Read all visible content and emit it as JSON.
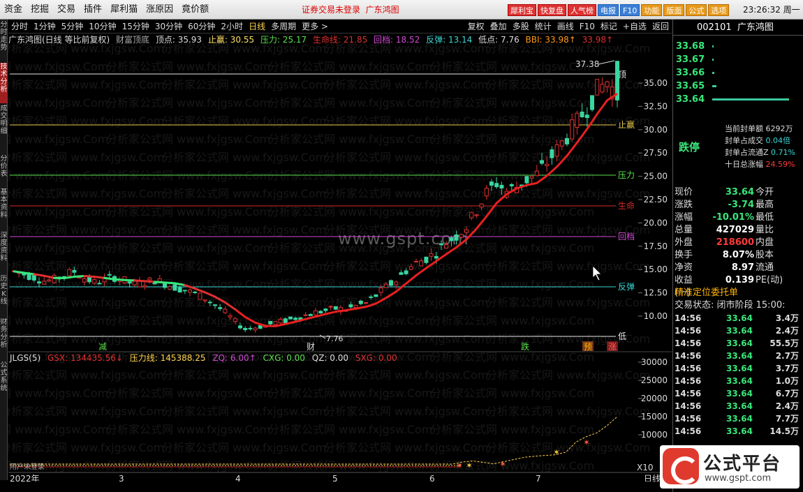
{
  "menu": {
    "items": [
      "资金",
      "挖掘",
      "交易",
      "插件",
      "犀利猫",
      "涨原因",
      "竟价额"
    ]
  },
  "account": {
    "status": "证券交易未登录",
    "name": "广东鸿图"
  },
  "topbuttons": [
    "犀利宝",
    "快复盘",
    "人气榜",
    "电报",
    "F10",
    "功能",
    "版面",
    "公式",
    "选项"
  ],
  "clock": "23:26:32 周一",
  "lefttabs": [
    "分时走势",
    "技术分析",
    "成交明细",
    "分价表",
    "基本资料",
    "深度资料",
    "历史K线",
    "财务分析",
    "公式系统"
  ],
  "periods": {
    "items": [
      "分时",
      "1分钟",
      "5分钟",
      "10分钟",
      "15分钟",
      "30分钟",
      "60分钟",
      "2小时",
      "日线",
      "多周期",
      "更多 >"
    ],
    "active": "日线"
  },
  "toolbar": [
    "复权",
    "叠加",
    "多股",
    "统计",
    "画线",
    "F10",
    "标记",
    "+自选",
    "返回"
  ],
  "info": {
    "title": "广东鸿图(日线 等比前复权)",
    "indicator": "财富顶底",
    "top": "顶点: 35.93",
    "stop": "止赢: 30.55",
    "press": "压力: 25.17",
    "life": "生命线: 21.85",
    "ret": "回档: 18.52",
    "rebound": "反弹: 13.14",
    "low": "低点: 7.76",
    "bbi": "BBI: 33.98↑",
    "bbi2": "33.98↑"
  },
  "levels": {
    "top": "顶",
    "stop": "止赢",
    "press": "压力",
    "life": "生命",
    "ret": "回档",
    "rebound": "反弹",
    "low": "低"
  },
  "pricelabels": {
    "high": "37.38",
    "low": "7.76"
  },
  "signals": {
    "s1": "减",
    "s2": "财",
    "s3": "跌",
    "s4": "预",
    "s5": "涨"
  },
  "indicator2": {
    "name": "JLGS(5)",
    "gsx": "GSX: 134435.56↓",
    "ylx": "压力线: 145388.25",
    "zq": "ZQ: 6.00↑",
    "cxg": "CXG: 0.00",
    "qz": "QZ: 0.00",
    "sxg": "SXG: 0.00",
    "foot": "用户未登录",
    "unit": "X10"
  },
  "xaxis": {
    "labels": [
      "2022年",
      "3",
      "4",
      "5",
      "6",
      "7"
    ],
    "right": "日线"
  },
  "rightpanel": {
    "code": "002101",
    "name": "广东鸿图",
    "orderbook": [
      {
        "price": "33.68",
        "bar": 2
      },
      {
        "price": "33.67",
        "bar": 2
      },
      {
        "price": "33.66",
        "bar": 3
      },
      {
        "price": "33.65",
        "bar": 6
      },
      {
        "price": "33.64",
        "bar": 110
      }
    ],
    "halt": {
      "label": "跌停",
      "r1": "当前封单额",
      "r1v": "6292万",
      "r2": "封单占成交",
      "r2v": "0.04倍",
      "r3": "封单占流通Z",
      "r3v": "0.71%",
      "r4": "十日总涨幅",
      "r4v": "24.59%"
    },
    "stats": [
      {
        "k": "现价",
        "v": "33.64",
        "c": "#38e77a",
        "k2": "今开"
      },
      {
        "k": "涨跌",
        "v": "-3.74",
        "c": "#38e77a",
        "k2": "最高"
      },
      {
        "k": "涨幅",
        "v": "-10.01%",
        "c": "#38e77a",
        "k2": "最低"
      },
      {
        "k": "总量",
        "v": "427029",
        "c": "#ffffff",
        "k2": "量比"
      },
      {
        "k": "外盘",
        "v": "218600",
        "c": "#ff3b3b",
        "k2": "内盘"
      },
      {
        "k": "换手",
        "v": "8.07%",
        "c": "#ffffff",
        "k2": "股本"
      },
      {
        "k": "净资",
        "v": "8.97",
        "c": "#ffffff",
        "k2": "流通"
      },
      {
        "k": "收益(一)",
        "v": "0.139",
        "c": "#ffffff",
        "k2": "PE(动)"
      }
    ],
    "section": "精准定位委托单",
    "tradestate": "交易状态: 闭市阶段 15:00:",
    "trades": [
      {
        "t": "14:56",
        "p": "33.64",
        "q": "3.4万"
      },
      {
        "t": "14:56",
        "p": "33.64",
        "q": "2.4万"
      },
      {
        "t": "14:56",
        "p": "33.64",
        "q": "55.5万"
      },
      {
        "t": "14:56",
        "p": "33.64",
        "q": "2.7万"
      },
      {
        "t": "14:56",
        "p": "33.64",
        "q": "3.7万"
      },
      {
        "t": "14:56",
        "p": "33.64",
        "q": "1.0万"
      },
      {
        "t": "14:56",
        "p": "33.64",
        "q": "6.7万"
      },
      {
        "t": "14:56",
        "p": "33.64",
        "q": "2.4万"
      },
      {
        "t": "14:56",
        "p": "33.64",
        "q": "7.7万"
      },
      {
        "t": "14:56",
        "p": "33.64",
        "q": "14.5万"
      }
    ]
  },
  "logo": {
    "name": "公式平台",
    "url": "www.gspt.com"
  },
  "watermark": {
    "big": "www.gspt.com",
    "tile": "分析家公式网 www.fxjgsw.Com"
  },
  "chart_data": [
    {
      "type": "candlestick",
      "title": "广东鸿图(日线 等比前复权)",
      "y_ticks": [
        "35.00",
        "32.50",
        "30.00",
        "27.50",
        "25.00",
        "22.50",
        "20.00",
        "17.50",
        "15.00",
        "12.50",
        "10.00"
      ],
      "ylim": [
        7.0,
        38.5
      ],
      "levels": [
        {
          "name": "顶点",
          "value": 35.93
        },
        {
          "name": "止赢",
          "value": 30.55
        },
        {
          "name": "压力",
          "value": 25.17
        },
        {
          "name": "生命线",
          "value": 21.85
        },
        {
          "name": "回档",
          "value": 18.52
        },
        {
          "name": "反弹",
          "value": 13.14
        },
        {
          "name": "低点",
          "value": 7.76
        }
      ],
      "close_path": [
        14.8,
        14.5,
        14.2,
        13.8,
        13.9,
        14.4,
        14.8,
        14.1,
        13.6,
        13.9,
        14.2,
        13.8,
        13.4,
        13.6,
        13.9,
        13.5,
        13.1,
        12.8,
        12.4,
        11.9,
        11.2,
        10.4,
        9.4,
        8.6,
        8.8,
        9.0,
        9.3,
        9.5,
        9.8,
        10.1,
        10.4,
        10.6,
        10.8,
        10.7,
        11.1,
        11.4,
        12.2,
        13.1,
        13.8,
        14.9,
        15.7,
        16.2,
        16.8,
        17.9,
        18.6,
        19.6,
        21.4,
        23.2,
        24.3,
        23.4,
        23.9,
        24.6,
        25.2,
        26.5,
        27.8,
        29.3,
        30.8,
        32.4,
        34.2,
        35.2,
        33.64
      ]
    },
    {
      "type": "line",
      "name": "JLGS(5)",
      "y_ticks": [
        "30000",
        "25000",
        "20000",
        "15000",
        "10000"
      ],
      "ylim": [
        0,
        32000
      ],
      "gsx_path": [
        0,
        0,
        0,
        0,
        0,
        0,
        0,
        0,
        0,
        0,
        0,
        0,
        0,
        0,
        0,
        0,
        0,
        0,
        0,
        0,
        0,
        0,
        0,
        0,
        0,
        0,
        0,
        0,
        0,
        0,
        0,
        0,
        0,
        0,
        0,
        0,
        0,
        0,
        0,
        0,
        0,
        0,
        500,
        1500,
        2500,
        2800,
        2400,
        2000,
        2600,
        3200,
        3800,
        4100,
        4300,
        4500,
        5200,
        8000,
        9500,
        10500,
        12500,
        15000
      ]
    }
  ]
}
